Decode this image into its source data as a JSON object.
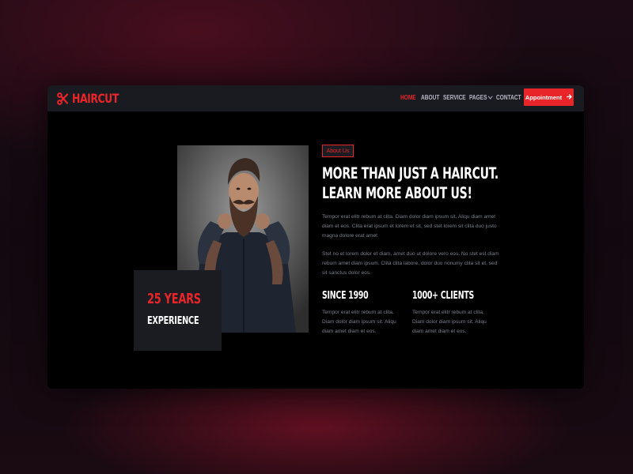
{
  "brand": {
    "name": "HAIRCUT",
    "icon": "scissors-icon",
    "accent_color": "#e8262a"
  },
  "nav": {
    "items": [
      {
        "label": "HOME",
        "active": true
      },
      {
        "label": "ABOUT"
      },
      {
        "label": "SERVICE"
      },
      {
        "label": "PAGES",
        "icon": "chevron-down-icon"
      },
      {
        "label": "CONTACT"
      }
    ],
    "cta_label": "Appointment",
    "cta_icon": "arrow-right-icon"
  },
  "experience": {
    "years": "25 YEARS",
    "label": "EXPERIENCE"
  },
  "about": {
    "badge": "About Us",
    "headline": "MORE THAN JUST A HAIRCUT. LEARN MORE ABOUT US!",
    "paragraph1": "Tempor erat elitr rebum at clita. Diam dolor diam ipsum sit. Aliqu diam amet diam et eos. Clita erat ipsum et lorem et sit, sed stet lorem sit clita duo justo magna dolore erat amet",
    "paragraph2": "Stet no et lorem dolor et diam, amet duo ut dolore vero eos. No stet est diam rebum amet diam ipsum. Clita clita labore, dolor duo nonumy clita sit et, sed sit sanctus dolor eos."
  },
  "stats": [
    {
      "title": "SINCE 1990",
      "text": "Tempor erat elitr rebum at clita. Diam dolor diam ipsum sit. Aliqu diam amet diam et eos."
    },
    {
      "title": "1000+ CLIENTS",
      "text": "Tempor erat elitr rebum at clita. Diam dolor diam ipsum sit. Aliqu diam amet diam et eos."
    }
  ]
}
